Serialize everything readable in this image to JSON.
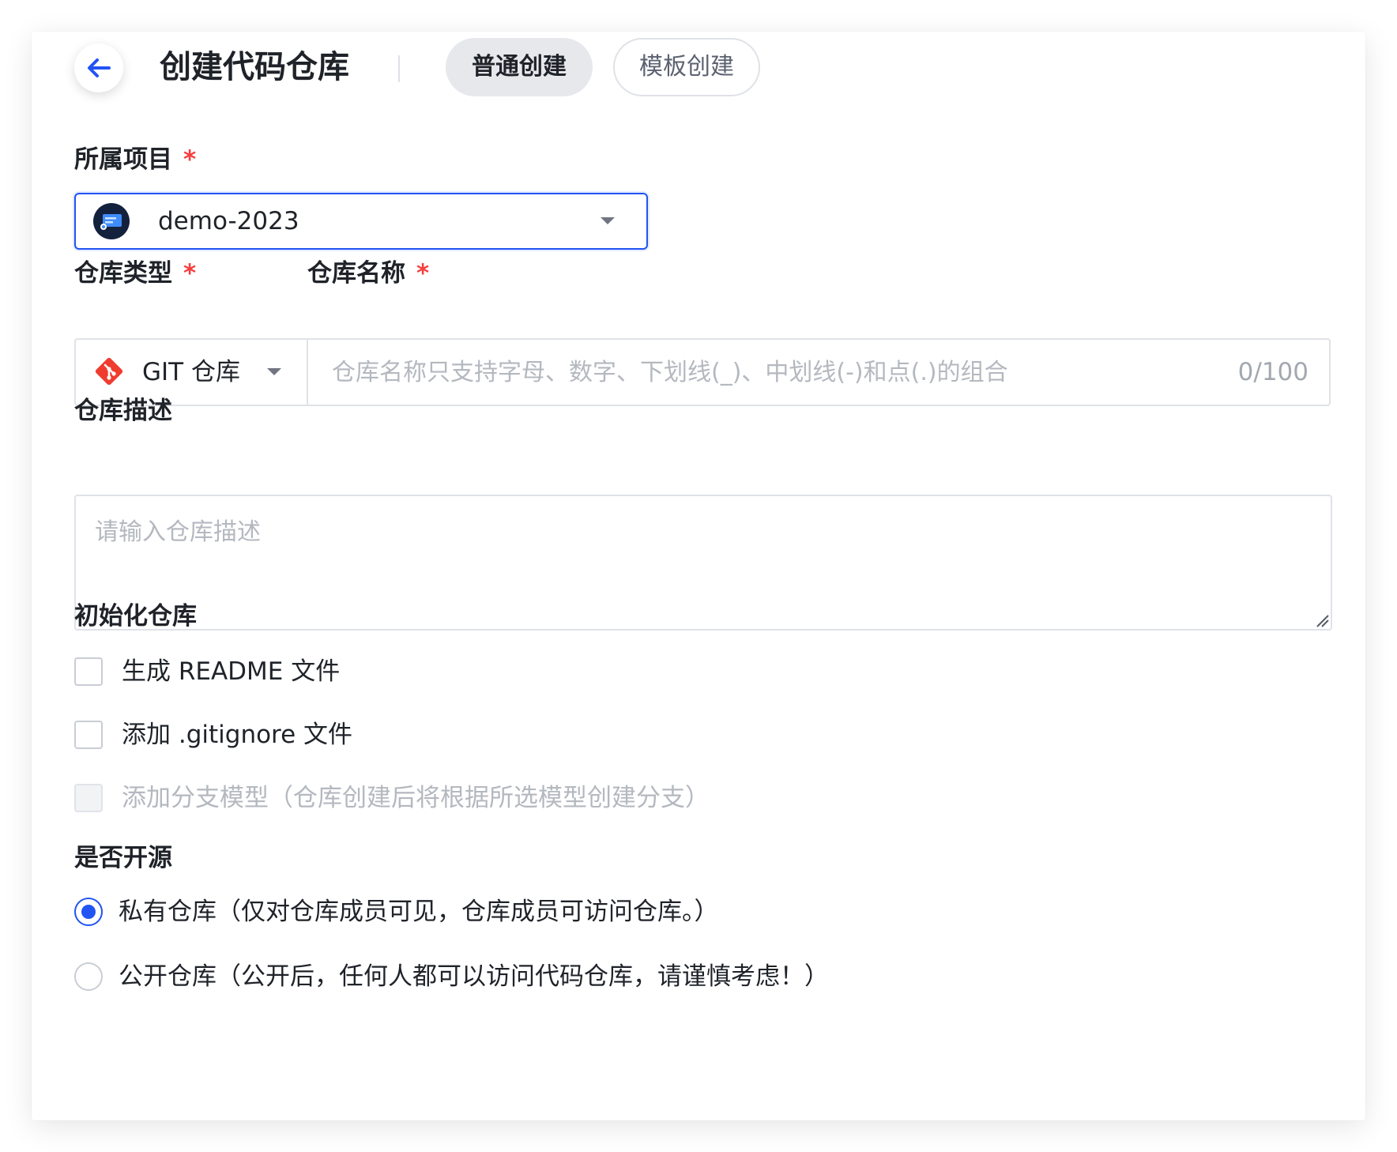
{
  "header": {
    "title": "创建代码仓库",
    "tabs": [
      {
        "label": "普通创建",
        "active": true
      },
      {
        "label": "模板创建",
        "active": false
      }
    ]
  },
  "project": {
    "label": "所属项目",
    "required_mark": "*",
    "selected": "demo-2023",
    "avatar_icon": "project-avatar-icon"
  },
  "repo_type": {
    "label": "仓库类型",
    "required_mark": "*",
    "selected": "GIT 仓库",
    "icon": "git-icon",
    "icon_color": "#f03c2e"
  },
  "repo_name": {
    "label": "仓库名称",
    "required_mark": "*",
    "placeholder": "仓库名称只支持字母、数字、下划线(_)、中划线(-)和点(.)的组合",
    "value": "",
    "counter": "0/100"
  },
  "description": {
    "label": "仓库描述",
    "placeholder": "请输入仓库描述",
    "value": ""
  },
  "init": {
    "label": "初始化仓库",
    "options": [
      {
        "label": "生成 README 文件",
        "checked": false,
        "disabled": false
      },
      {
        "label": "添加 .gitignore 文件",
        "checked": false,
        "disabled": false
      },
      {
        "label": "添加分支模型（仓库创建后将根据所选模型创建分支）",
        "checked": false,
        "disabled": true
      }
    ]
  },
  "visibility": {
    "label": "是否开源",
    "options": [
      {
        "label": "私有仓库（仅对仓库成员可见，仓库成员可访问仓库。）",
        "checked": true
      },
      {
        "label": "公开仓库（公开后，任何人都可以访问代码仓库，请谨慎考虑！）",
        "checked": false
      }
    ]
  },
  "colors": {
    "accent": "#2254f4",
    "required": "#f53f3f",
    "placeholder": "#b4b8bf",
    "border": "#dfe2e7"
  }
}
